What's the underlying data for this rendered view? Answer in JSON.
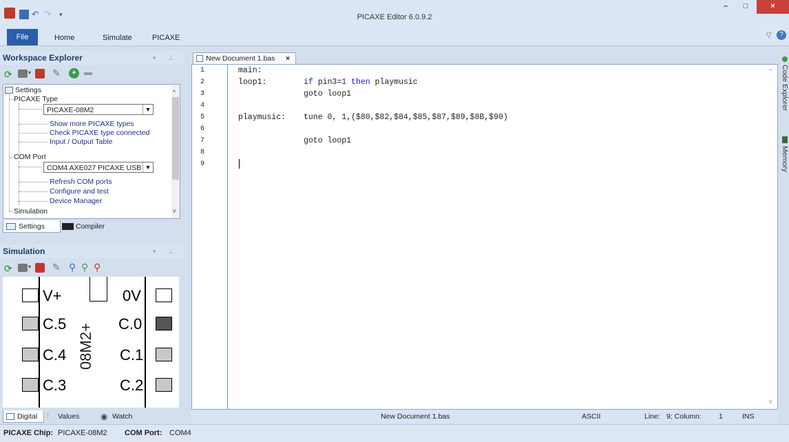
{
  "window": {
    "title": "PICAXE Editor 6.0.9.2"
  },
  "ribbon": {
    "tabs": [
      "File",
      "Home",
      "Simulate",
      "PICAXE"
    ]
  },
  "workspace": {
    "title": "Workspace Explorer",
    "tree": {
      "settings": "Settings",
      "picaxe_type": "PICAXE Type",
      "chip_select": "PICAXE-08M2",
      "show_more": "Show more PICAXE types",
      "check_type": "Check PICAXE type connected",
      "io_table": "Input / Output Table",
      "com_port": "COM Port",
      "com_select": "COM4 AXE027 PICAXE USB",
      "refresh": "Refresh COM ports",
      "configure": "Configure and test",
      "device_manager": "Device Manager",
      "simulation": "Simulation"
    },
    "tabs": [
      "Settings",
      "Compiler"
    ]
  },
  "simulation": {
    "title": "Simulation",
    "chip": {
      "name": "08M2+",
      "pins_left": [
        "V+",
        "C.5",
        "C.4",
        "C.3"
      ],
      "pins_right": [
        "0V",
        "C.0",
        "C.1",
        "C.2"
      ]
    },
    "tabs": [
      "Digital",
      "Values",
      "Watch"
    ]
  },
  "editor": {
    "tab_title": "New Document 1.bas",
    "line_numbers": [
      "1",
      "2",
      "3",
      "4",
      "5",
      "6",
      "7",
      "8",
      "9"
    ],
    "lines": {
      "l1": "main:",
      "l2_label": "loop1:",
      "l2_kw1": "if",
      "l2_mid": " pin3=",
      "l2_num": "1",
      "l2_kw2": " then",
      "l2_rest": " playmusic",
      "l3": "goto loop1",
      "l5_label": "playmusic:",
      "l5_code": "tune 0, 1,($80,$82,$84,$85,$87,$89,$8B,$90)",
      "l7": "goto loop1"
    }
  },
  "side_panel": {
    "items": [
      "Code Explorer",
      "Memory"
    ]
  },
  "status": {
    "document": "New Document 1.bas",
    "encoding": "ASCII",
    "line_label": "Line:",
    "line_value": "9; Column:",
    "column_value": "1",
    "mode": "INS"
  },
  "bottom": {
    "chip_label": "PICAXE Chip:",
    "chip_value": "PICAXE-08M2",
    "port_label": "COM Port:",
    "port_value": "COM4"
  },
  "colors": {
    "accent": "#2b5da8",
    "keyword": "#1a1ad6",
    "close": "#c7403a"
  }
}
